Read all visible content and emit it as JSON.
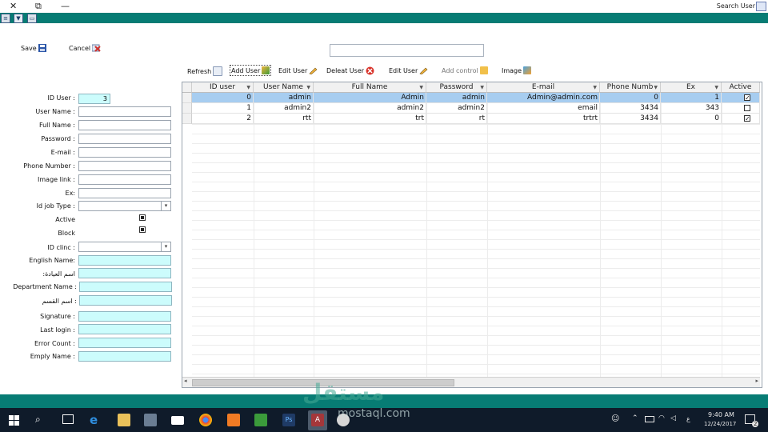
{
  "window": {
    "title": "Search User",
    "close": "✕",
    "restore": "⧉",
    "minimize": "—"
  },
  "toolbar_top": {
    "save": "Save",
    "cancel": "Cancel"
  },
  "toolbar": {
    "refresh": "Refresh",
    "add_user": "Add User",
    "edit_user_1": "Edit User",
    "delete_user": "Deleat User",
    "edit_user_2": "Edit User",
    "add_control": "Add control",
    "image": "Image"
  },
  "form": {
    "id_user_label": "ID User :",
    "id_user_value": "3",
    "user_name_label": "User Name :",
    "full_name_label": "Full Name :",
    "password_label": "Password :",
    "email_label": "E-mail :",
    "phone_label": "Phone Number :",
    "image_link_label": "Image link :",
    "ex_label": "Ex:",
    "job_type_label": "Id job Type :",
    "active_label": "Active",
    "block_label": "Block",
    "clinic_label": "ID clinc :",
    "english_name_label": "English Name:",
    "clinic_name_ar_label": ":اسم العيادة",
    "department_name_label": "Department Name :",
    "department_name_ar_label": "اسم القسم :",
    "signature_label": "Signature :",
    "last_login_label": "Last login :",
    "error_count_label": "Error Count :",
    "employee_name_label": "Emply Name :"
  },
  "grid": {
    "columns": [
      "ID user",
      "User Name",
      "Full Name",
      "Password",
      "E-mail",
      "Phone Numb",
      "Ex",
      "Active"
    ],
    "rows": [
      {
        "id": "0",
        "user": "admin",
        "full": "Admin",
        "pass": "admin",
        "email": "Admin@admin.com",
        "phone": "0",
        "ex": "1",
        "active": true
      },
      {
        "id": "1",
        "user": "admin2",
        "full": "admin2",
        "pass": "admin2",
        "email": "email",
        "phone": "3434",
        "ex": "343",
        "active": false
      },
      {
        "id": "2",
        "user": "rtt",
        "full": "trt",
        "pass": "rt",
        "email": "trtrt",
        "phone": "3434",
        "ex": "0",
        "active": true
      }
    ]
  },
  "taskbar": {
    "time": "9:40 AM",
    "date": "12/24/2017",
    "lang": "ع",
    "notifications": "2"
  },
  "watermark": {
    "ar": "مستقل",
    "en": "mostaql.com"
  },
  "colors": {
    "teal": "#077c74",
    "selected_row": "#a7cdf0",
    "input_cyan": "#ccfcfc"
  }
}
